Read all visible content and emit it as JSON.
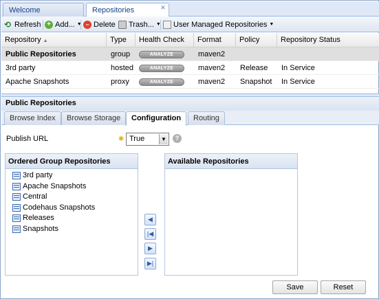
{
  "tabs": [
    {
      "label": "Welcome",
      "active": false
    },
    {
      "label": "Repositories",
      "active": true,
      "closable": true
    }
  ],
  "toolbar": {
    "refresh": "Refresh",
    "add": "Add...",
    "delete": "Delete",
    "trash": "Trash...",
    "user_managed": "User Managed Repositories"
  },
  "grid": {
    "columns": [
      "Repository",
      "Type",
      "Health Check",
      "Format",
      "Policy",
      "Repository Status"
    ],
    "sort_indicator": "▲",
    "analyze_label": "ANALYZE",
    "rows": [
      {
        "repository": "Public Repositories",
        "type": "group",
        "format": "maven2",
        "policy": "",
        "status": "",
        "selected": true
      },
      {
        "repository": "3rd party",
        "type": "hosted",
        "format": "maven2",
        "policy": "Release",
        "status": "In Service",
        "selected": false
      },
      {
        "repository": "Apache Snapshots",
        "type": "proxy",
        "format": "maven2",
        "policy": "Snapshot",
        "status": "In Service",
        "selected": false
      }
    ]
  },
  "detail": {
    "title": "Public Repositories",
    "subtabs": [
      {
        "label": "Browse Index",
        "active": false
      },
      {
        "label": "Browse Storage",
        "active": false
      },
      {
        "label": "Configuration",
        "active": true
      },
      {
        "label": "Routing",
        "active": false
      }
    ],
    "publish_url": {
      "label": "Publish URL",
      "value": "True"
    },
    "ordered_group": {
      "title": "Ordered Group Repositories",
      "items": [
        "3rd party",
        "Apache Snapshots",
        "Central",
        "Codehaus Snapshots",
        "Releases",
        "Snapshots"
      ]
    },
    "available": {
      "title": "Available Repositories",
      "items": []
    },
    "buttons": {
      "save": "Save",
      "reset": "Reset"
    }
  },
  "colors": {
    "tab_border": "#99bbe8",
    "header_text": "#15428b",
    "selected_row": "#dfdfdf",
    "required_star": "#e8b000"
  },
  "icons": [
    "refresh-icon",
    "add-icon",
    "delete-icon",
    "trash-icon",
    "repository-icon",
    "help-icon",
    "arrow-left-icon",
    "arrow-first-icon",
    "arrow-right-icon",
    "arrow-last-icon"
  ]
}
